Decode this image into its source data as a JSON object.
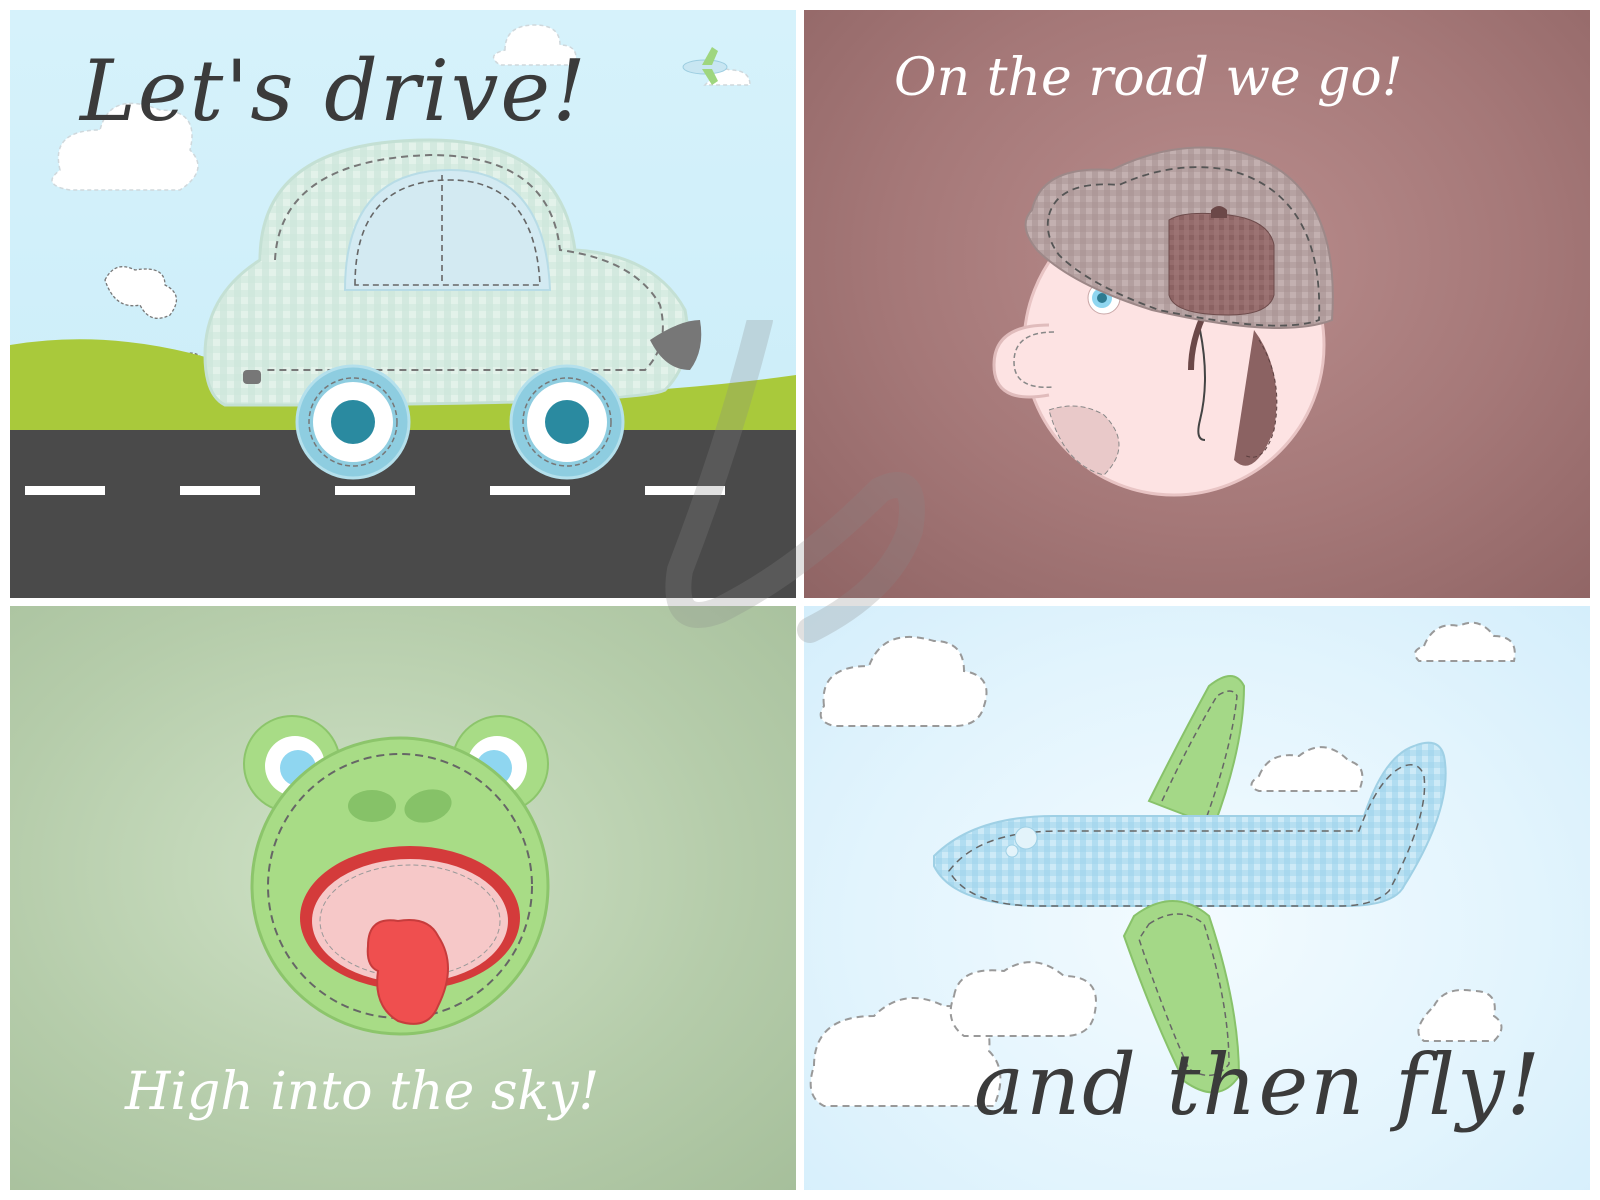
{
  "panels": {
    "car": {
      "caption": "Let's drive!"
    },
    "man": {
      "caption": "On the road we go!"
    },
    "frog": {
      "caption": "High into the sky!"
    },
    "plane": {
      "caption": "and then fly!"
    }
  },
  "colors": {
    "sky": "#d6f2fb",
    "grass": "#a9c93b",
    "road": "#4a4a4a",
    "car_body": "#dcefe6",
    "wheel": "#8ecde0",
    "hub": "#2a8aa0",
    "man_bg": "#a57878",
    "hat": "#b8a2a2",
    "frog_bg": "#b5ccaa",
    "frog": "#a8dc86",
    "mouth": "#d43b3b",
    "tongue": "#ef4f4f",
    "plane": "#bfe4f4",
    "plane_wing": "#a4d887"
  }
}
